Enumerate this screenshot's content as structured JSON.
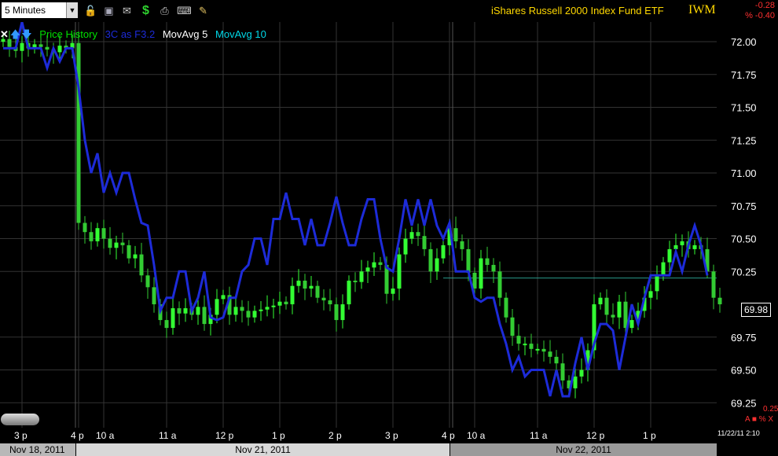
{
  "toolbar": {
    "interval": "5 Minutes",
    "fund_name": "iShares Russell 2000 Index Fund ETF",
    "symbol": "IWM",
    "change_abs": "-0.28",
    "change_pct": "% -0.40",
    "icons": [
      "lock-icon",
      "save-icon",
      "mail-icon",
      "dollar-icon",
      "print-icon",
      "keyboard-icon",
      "pencil-icon"
    ]
  },
  "legend": {
    "items": [
      {
        "label": "Price History",
        "color": "#00e000"
      },
      {
        "label": "3C as F3.2",
        "color": "#1d2bd8"
      },
      {
        "label": "MovAvg 5",
        "color": "#ffffff"
      },
      {
        "label": "MovAvg 10",
        "color": "#00d8e8"
      }
    ]
  },
  "last_price": "69.98",
  "sub_panel": {
    "value": "0.25",
    "icons": "A ■ % X"
  },
  "timestamp": "11/22/11 2:10",
  "date_bar": [
    {
      "label": "Nov 18, 2011",
      "bg": "#b8b8b8"
    },
    {
      "label": "Nov 21, 2011",
      "bg": "#d8d8d8"
    },
    {
      "label": "Nov 22, 2011",
      "bg": "#9a9a9a"
    }
  ],
  "colors": {
    "up": "#33ff33",
    "down": "#33cc33",
    "indicator": "#1d2bd8",
    "grid": "#333333",
    "price_axis": "#ffffff"
  },
  "chart_data": {
    "type": "line",
    "ylim": [
      69.12,
      72.15
    ],
    "yticks": [
      72.0,
      71.75,
      71.5,
      71.25,
      71.0,
      70.75,
      70.5,
      70.25,
      69.98,
      69.75,
      69.5,
      69.25
    ],
    "xticks": [
      {
        "label": "3 p",
        "bar": 3
      },
      {
        "label": "4 p",
        "bar": 12
      },
      {
        "label": "10 a",
        "bar": 16
      },
      {
        "label": "11 a",
        "bar": 26
      },
      {
        "label": "12 p",
        "bar": 35
      },
      {
        "label": "1 p",
        "bar": 44
      },
      {
        "label": "2 p",
        "bar": 53
      },
      {
        "label": "3 p",
        "bar": 62
      },
      {
        "label": "4 p",
        "bar": 71
      },
      {
        "label": "10 a",
        "bar": 75
      },
      {
        "label": "11 a",
        "bar": 85
      },
      {
        "label": "12 p",
        "bar": 94
      },
      {
        "label": "1 p",
        "bar": 103
      }
    ],
    "reference_line": 70.2,
    "series": [
      {
        "name": "Price History",
        "close": [
          72.02,
          71.96,
          71.93,
          71.99,
          71.95,
          71.98,
          71.96,
          71.94,
          71.92,
          71.97,
          71.95,
          71.99,
          70.62,
          70.55,
          70.48,
          70.58,
          70.5,
          70.43,
          70.47,
          70.45,
          70.35,
          70.38,
          70.22,
          70.13,
          70.0,
          69.88,
          69.82,
          69.97,
          69.93,
          69.97,
          69.92,
          69.98,
          69.85,
          69.92,
          70.04,
          70.07,
          69.92,
          69.98,
          69.95,
          69.9,
          69.95,
          69.96,
          69.98,
          69.99,
          70.02,
          70.0,
          70.14,
          70.18,
          70.12,
          70.14,
          70.05,
          70.03,
          70.0,
          69.88,
          70.0,
          70.18,
          70.17,
          70.25,
          70.28,
          70.32,
          70.3,
          70.08,
          70.12,
          70.38,
          70.5,
          70.55,
          70.52,
          70.42,
          70.25,
          70.35,
          70.45,
          70.58,
          70.48,
          70.42,
          70.24,
          70.12,
          70.35,
          70.3,
          70.25,
          70.05,
          69.9,
          69.76,
          69.7,
          69.7,
          69.66,
          69.66,
          69.64,
          69.6,
          69.55,
          69.42,
          69.36,
          69.45,
          69.5,
          69.65,
          70.0,
          70.05,
          69.92,
          69.9,
          70.02,
          69.82,
          69.88,
          69.95,
          70.05,
          70.1,
          70.22,
          70.32,
          70.42,
          70.45,
          70.48,
          70.42,
          70.45,
          70.42,
          70.25,
          70.05,
          70.0
        ]
      },
      {
        "name": "3C as F3.2",
        "values": [
          71.95,
          71.95,
          71.95,
          72.15,
          71.95,
          71.95,
          71.95,
          71.8,
          71.95,
          71.85,
          71.95,
          71.95,
          71.65,
          71.25,
          71.0,
          71.15,
          70.85,
          71.0,
          70.85,
          71.0,
          71.0,
          70.8,
          70.62,
          70.6,
          70.3,
          69.95,
          70.05,
          70.05,
          70.25,
          70.25,
          69.95,
          70.05,
          70.25,
          69.9,
          69.88,
          69.9,
          70.05,
          70.05,
          70.25,
          70.3,
          70.5,
          70.5,
          70.3,
          70.65,
          70.65,
          70.85,
          70.65,
          70.65,
          70.45,
          70.65,
          70.45,
          70.45,
          70.62,
          70.82,
          70.62,
          70.45,
          70.45,
          70.65,
          70.8,
          70.8,
          70.5,
          70.28,
          70.25,
          70.5,
          70.8,
          70.6,
          70.8,
          70.6,
          70.8,
          70.6,
          70.5,
          70.62,
          70.25,
          70.25,
          70.25,
          70.05,
          70.02,
          70.05,
          70.05,
          69.85,
          69.7,
          69.5,
          69.6,
          69.45,
          69.5,
          69.5,
          69.5,
          69.3,
          69.5,
          69.3,
          69.3,
          69.55,
          69.75,
          69.5,
          69.7,
          69.85,
          69.85,
          69.8,
          69.5,
          69.75,
          70.0,
          69.85,
          70.05,
          70.22,
          70.22,
          70.22,
          70.22,
          70.4,
          70.25,
          70.45,
          70.6,
          70.45,
          70.22
        ]
      }
    ]
  }
}
